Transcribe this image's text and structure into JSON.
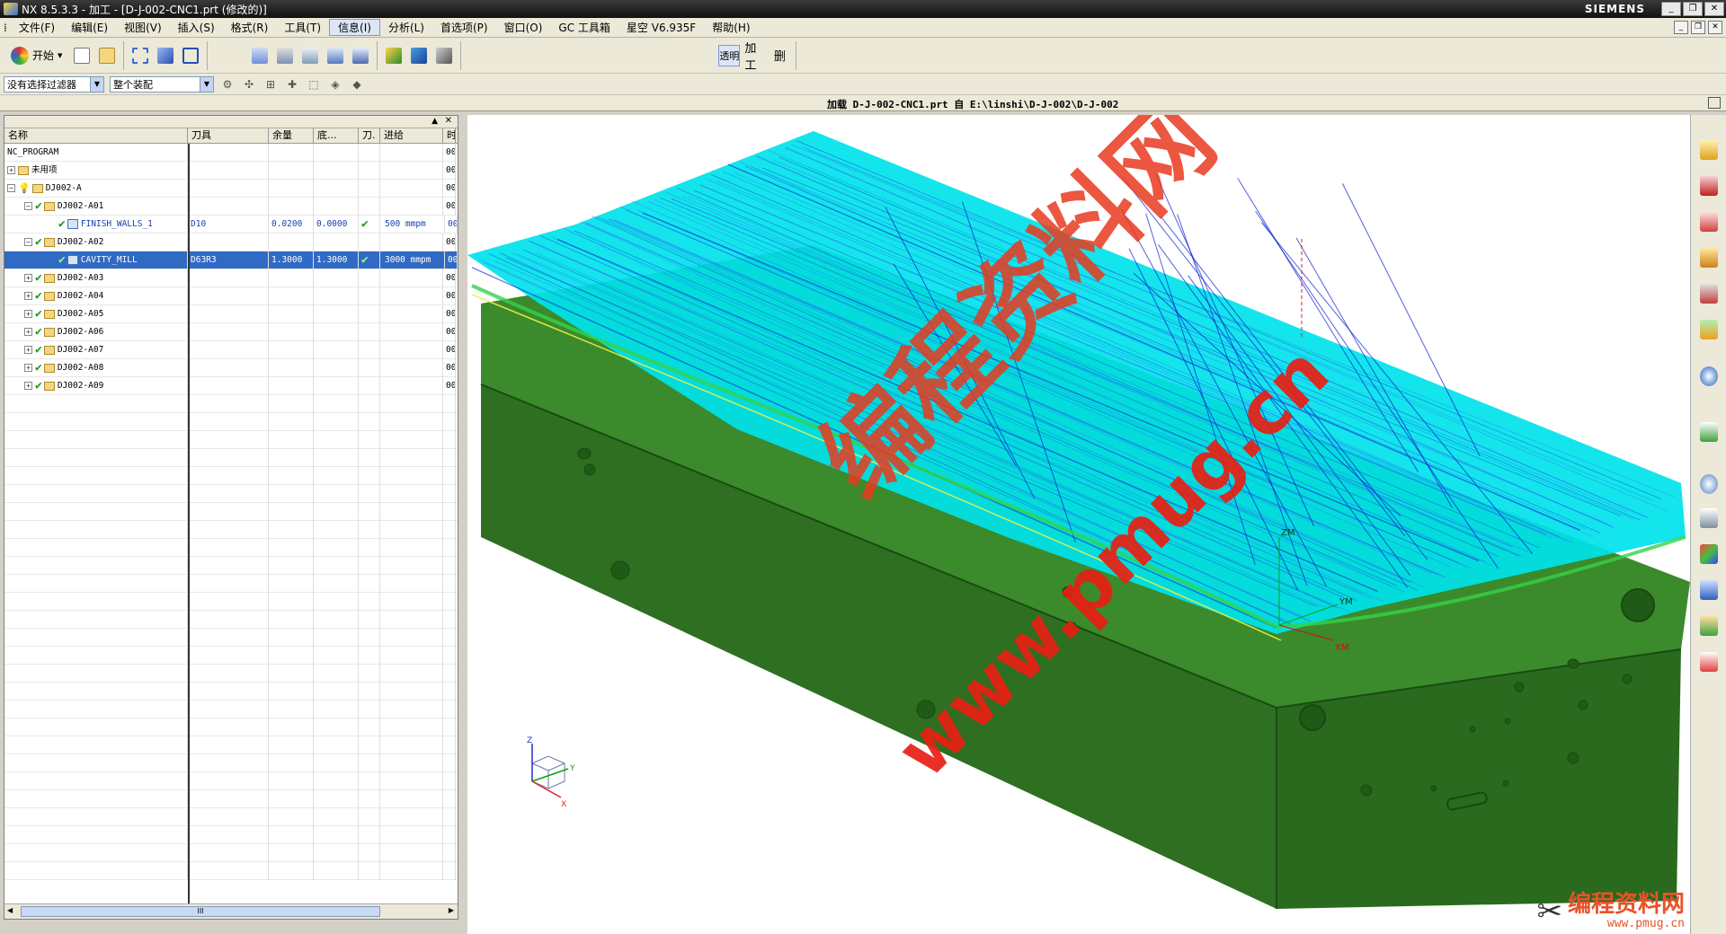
{
  "titlebar": {
    "title": "NX 8.5.3.3 - 加工 - [D-J-002-CNC1.prt (修改的)]",
    "brand": "SIEMENS"
  },
  "menu": [
    "文件(F)",
    "编辑(E)",
    "视图(V)",
    "插入(S)",
    "格式(R)",
    "工具(T)",
    "信息(I)",
    "分析(L)",
    "首选项(P)",
    "窗口(O)",
    "GC 工具箱",
    "星空 V6.935F",
    "帮助(H)"
  ],
  "toolbar": {
    "start_label": "开始",
    "right_labels": [
      "透明",
      "加工",
      "删"
    ]
  },
  "selection": {
    "filter": "没有选择过滤器",
    "scope": "整个装配"
  },
  "status": {
    "text": "加载 D-J-002-CNC1.prt 自 E:\\linshi\\D-J-002\\D-J-002"
  },
  "navigator": {
    "columns": [
      "名称",
      "刀具",
      "余量",
      "底...",
      "刀.",
      "进给",
      "时"
    ],
    "rows": [
      {
        "name": "NC_PROGRAM",
        "tool": "",
        "stock": "",
        "floor": "",
        "tk": "",
        "feed": "",
        "time": "00"
      },
      {
        "name": "未用项",
        "tool": "",
        "stock": "",
        "floor": "",
        "tk": "",
        "feed": "",
        "time": "00"
      },
      {
        "name": "DJ002-A",
        "tool": "",
        "stock": "",
        "floor": "",
        "tk": "",
        "feed": "",
        "time": "00"
      },
      {
        "name": "DJ002-A01",
        "tool": "",
        "stock": "",
        "floor": "",
        "tk": "",
        "feed": "",
        "time": "00"
      },
      {
        "name": "FINISH_WALLS_1",
        "tool": "D10",
        "stock": "0.0200",
        "floor": "0.0000",
        "tk": "✔",
        "feed": "500 mmpm",
        "time": "00"
      },
      {
        "name": "DJ002-A02",
        "tool": "",
        "stock": "",
        "floor": "",
        "tk": "",
        "feed": "",
        "time": "00"
      },
      {
        "name": "CAVITY_MILL",
        "tool": "D63R3",
        "stock": "1.3000",
        "floor": "1.3000",
        "tk": "✔",
        "feed": "3000 mmpm",
        "time": "00"
      },
      {
        "name": "DJ002-A03",
        "tool": "",
        "stock": "",
        "floor": "",
        "tk": "",
        "feed": "",
        "time": "00"
      },
      {
        "name": "DJ002-A04",
        "tool": "",
        "stock": "",
        "floor": "",
        "tk": "",
        "feed": "",
        "time": "00"
      },
      {
        "name": "DJ002-A05",
        "tool": "",
        "stock": "",
        "floor": "",
        "tk": "",
        "feed": "",
        "time": "00"
      },
      {
        "name": "DJ002-A06",
        "tool": "",
        "stock": "",
        "floor": "",
        "tk": "",
        "feed": "",
        "time": "00"
      },
      {
        "name": "DJ002-A07",
        "tool": "",
        "stock": "",
        "floor": "",
        "tk": "",
        "feed": "",
        "time": "00"
      },
      {
        "name": "DJ002-A08",
        "tool": "",
        "stock": "",
        "floor": "",
        "tk": "",
        "feed": "",
        "time": "00"
      },
      {
        "name": "DJ002-A09",
        "tool": "",
        "stock": "",
        "floor": "",
        "tk": "",
        "feed": "",
        "time": "00"
      }
    ],
    "scroll_label": "III"
  },
  "viewport": {
    "axis_labels": {
      "zm": "ZM",
      "ym": "YM",
      "xm": "XM",
      "z": "Z",
      "y": "Y",
      "x": "X"
    },
    "colors": {
      "part": "#2d6f1f",
      "part_top": "#3a8a2a",
      "toolpath": "#00e5e8",
      "toolpath_edge": "#0a20d0"
    }
  },
  "watermark": {
    "big": "编程资料网",
    "url": "www.pmug.cn",
    "logo_text": "编程资料网",
    "logo_url": "www.pmug.cn"
  }
}
